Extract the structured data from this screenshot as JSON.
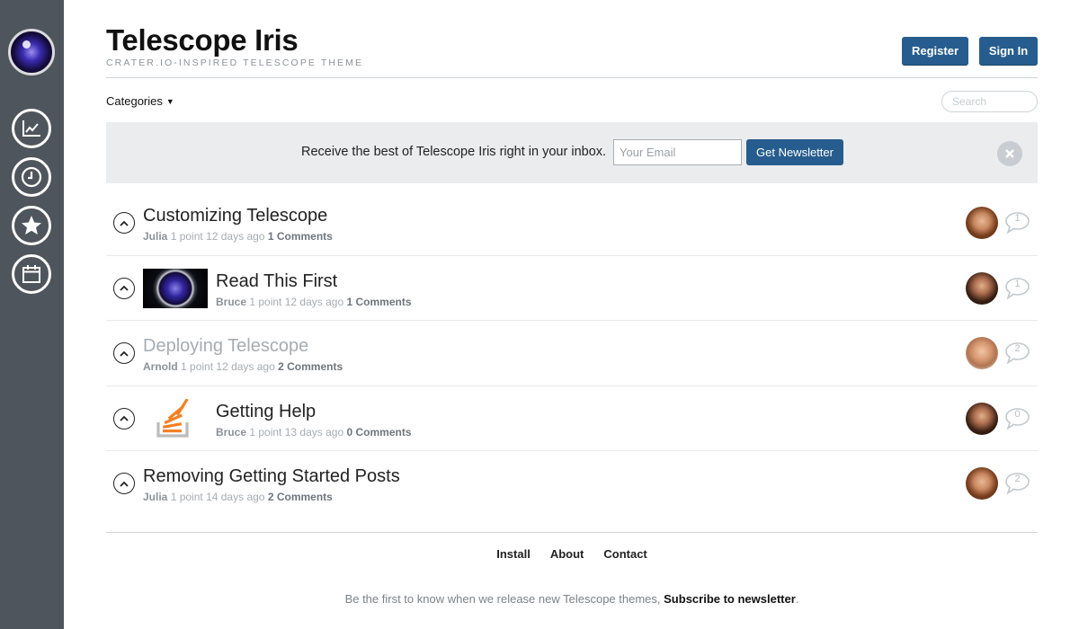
{
  "site": {
    "title": "Telescope Iris",
    "tagline": "CRATER.IO-INSPIRED TELESCOPE THEME",
    "register_label": "Register",
    "signin_label": "Sign In"
  },
  "sidebar": {
    "items": [
      {
        "icon": "trending-chart-icon"
      },
      {
        "icon": "clock-icon"
      },
      {
        "icon": "star-icon"
      },
      {
        "icon": "calendar-icon"
      }
    ]
  },
  "toolbar": {
    "categories_label": "Categories",
    "search_placeholder": "Search"
  },
  "newsletter": {
    "text": "Receive the best of Telescope Iris right in your inbox.",
    "email_placeholder": "Your Email",
    "button_label": "Get Newsletter"
  },
  "posts": [
    {
      "title": "Customizing Telescope",
      "author": "Julia",
      "points": "1 point",
      "age": "12 days ago",
      "comments": "1 Comments",
      "comment_count": "1"
    },
    {
      "title": "Read This First",
      "author": "Bruce",
      "points": "1 point",
      "age": "12 days ago",
      "comments": "1 Comments",
      "comment_count": "1"
    },
    {
      "title": "Deploying Telescope",
      "author": "Arnold",
      "points": "1 point",
      "age": "12 days ago",
      "comments": "2 Comments",
      "comment_count": "2"
    },
    {
      "title": "Getting Help",
      "author": "Bruce",
      "points": "1 point",
      "age": "13 days ago",
      "comments": "0 Comments",
      "comment_count": "0"
    },
    {
      "title": "Removing Getting Started Posts",
      "author": "Julia",
      "points": "1 point",
      "age": "14 days ago",
      "comments": "2 Comments",
      "comment_count": "2"
    }
  ],
  "footer": {
    "links": [
      "Install",
      "About",
      "Contact"
    ],
    "note": "Be the first to know when we release new Telescope themes,",
    "subscribe_label": "Subscribe to newsletter",
    "note_end": "."
  },
  "colors": {
    "sidebar": "#4e555c",
    "primary_button": "#265d8e",
    "newsletter_bg": "#ebecee"
  }
}
